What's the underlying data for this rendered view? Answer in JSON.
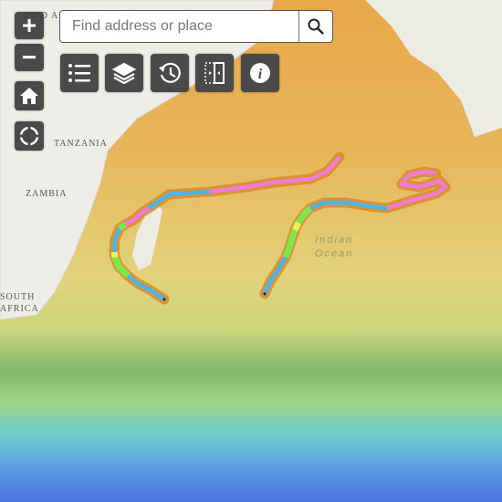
{
  "search": {
    "placeholder": "Find address or place",
    "value": ""
  },
  "zoom": {
    "in_label": "+",
    "out_label": "−"
  },
  "toolbar": {
    "buttons": [
      {
        "icon": "legend-list-icon"
      },
      {
        "icon": "layers-icon"
      },
      {
        "icon": "time-history-icon"
      },
      {
        "icon": "swipe-compare-icon"
      },
      {
        "icon": "info-icon"
      }
    ]
  },
  "map": {
    "labels": {
      "sudan": "SUD A",
      "tanzania": "TANZANIA",
      "zambia": "ZAMBIA",
      "south": "SOUTH",
      "africa": "AFRICA",
      "ocean_line1": "Indian",
      "ocean_line2": "Ocean"
    },
    "track_colors": {
      "blue": "#4bb4e6",
      "green": "#7ee84a",
      "pink": "#ef7bd8",
      "yellow": "#f4f05a",
      "halo": "#d88a2a"
    }
  }
}
